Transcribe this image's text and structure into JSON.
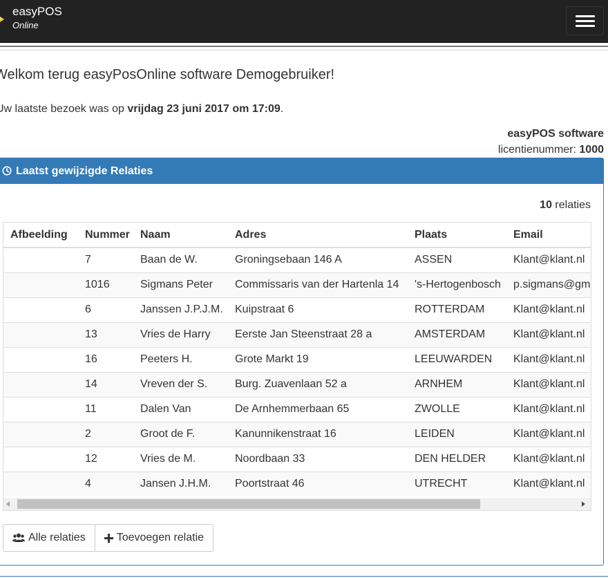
{
  "navbar": {
    "brand_title": "easyPOS",
    "brand_subtitle": "Online"
  },
  "welcome": {
    "greeting": "Welkom terug easyPosOnline software Demogebruiker!",
    "visit_prefix": "Uw laatste bezoek was op ",
    "visit_date": "vrijdag 23 juni 2017 om 17:09",
    "visit_suffix": "."
  },
  "license": {
    "company": "easyPOS software",
    "label": "licentienummer: ",
    "number": "1000"
  },
  "panel": {
    "title": "Laatst gewijzigde Relaties",
    "count_number": "10",
    "count_label": " relaties",
    "columns": [
      "Afbeelding",
      "Nummer",
      "Naam",
      "Adres",
      "Plaats",
      "Email"
    ],
    "rows": [
      {
        "afbeelding": "",
        "nummer": "7",
        "naam": "Baan de W.",
        "adres": "Groningsebaan 146 A",
        "plaats": "ASSEN",
        "email": "Klant@klant.nl"
      },
      {
        "afbeelding": "",
        "nummer": "1016",
        "naam": "Sigmans Peter",
        "adres": "Commissaris van der Hartenla 14",
        "plaats": "'s-Hertogenbosch",
        "email": "p.sigmans@gm"
      },
      {
        "afbeelding": "",
        "nummer": "6",
        "naam": "Janssen J.P.J.M.",
        "adres": "Kuipstraat 6",
        "plaats": "ROTTERDAM",
        "email": "Klant@klant.nl"
      },
      {
        "afbeelding": "",
        "nummer": "13",
        "naam": "Vries de Harry",
        "adres": "Eerste Jan Steenstraat 28 a",
        "plaats": "AMSTERDAM",
        "email": "Klant@klant.nl"
      },
      {
        "afbeelding": "",
        "nummer": "16",
        "naam": "Peeters H.",
        "adres": "Grote Markt 19",
        "plaats": "LEEUWARDEN",
        "email": "Klant@klant.nl"
      },
      {
        "afbeelding": "",
        "nummer": "14",
        "naam": "Vreven der S.",
        "adres": "Burg. Zuavenlaan 52 a",
        "plaats": "ARNHEM",
        "email": "Klant@klant.nl"
      },
      {
        "afbeelding": "",
        "nummer": "11",
        "naam": "Dalen Van",
        "adres": "De Arnhemmerbaan 65",
        "plaats": "ZWOLLE",
        "email": "Klant@klant.nl"
      },
      {
        "afbeelding": "",
        "nummer": "2",
        "naam": "Groot de F.",
        "adres": "Kanunnikenstraat 16",
        "plaats": "LEIDEN",
        "email": "Klant@klant.nl"
      },
      {
        "afbeelding": "",
        "nummer": "12",
        "naam": "Vries de M.",
        "adres": "Noordbaan 33",
        "plaats": "DEN HELDER",
        "email": "Klant@klant.nl"
      },
      {
        "afbeelding": "",
        "nummer": "4",
        "naam": "Jansen J.H.M.",
        "adres": "Poortstraat 46",
        "plaats": "UTRECHT",
        "email": "Klant@klant.nl"
      }
    ],
    "buttons": {
      "all_relations": "Alle relaties",
      "add_relation": "Toevoegen relatie"
    }
  },
  "colors": {
    "navbar_bg": "#222222",
    "primary": "#337ab7",
    "logo_accent": "#f0c419"
  },
  "icons": {
    "menu": "hamburger-icon",
    "panel_heading": "clock-icon",
    "all_relations": "users-icon",
    "add_relation": "plus-icon"
  }
}
